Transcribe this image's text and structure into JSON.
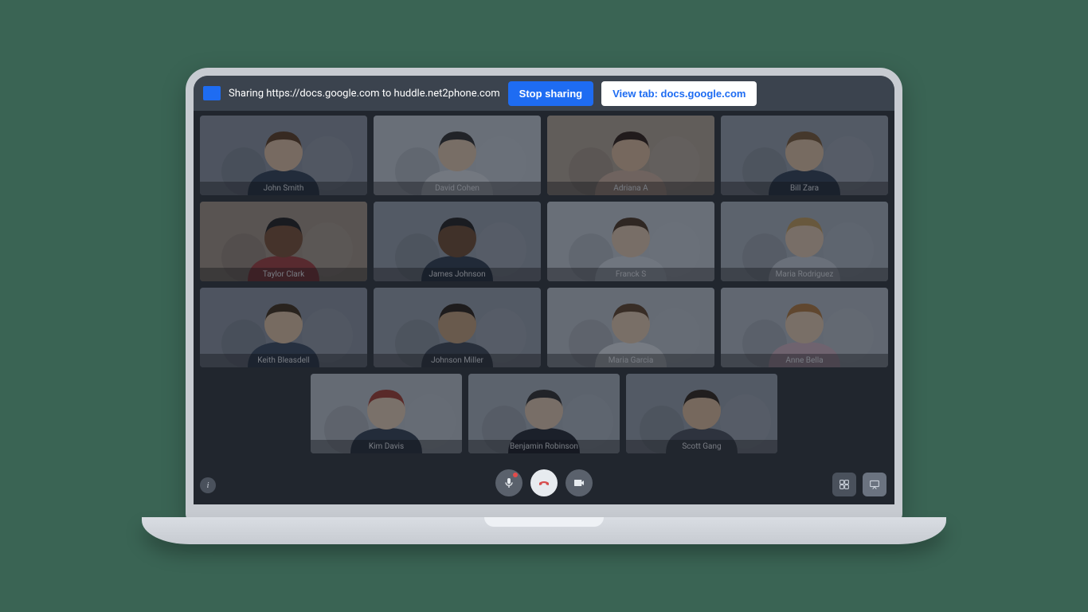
{
  "share_bar": {
    "sharing_text": "Sharing https://docs.google.com to huddle.net2phone.com",
    "stop_label": "Stop sharing",
    "view_label": "View tab: docs.google.com"
  },
  "participants": [
    {
      "name": "John Smith",
      "skin": "#e8c7a8",
      "hair": "#5b3a1e",
      "shirt": "#2d3e55"
    },
    {
      "name": "David Cohen",
      "skin": "#ecd0b3",
      "hair": "#2c2c2c",
      "shirt": "#dfe6ee"
    },
    {
      "name": "Adriana A",
      "skin": "#e6c4a2",
      "hair": "#2a1a10",
      "shirt": "#d7b8a4"
    },
    {
      "name": "Bill Zara",
      "skin": "#e9caa9",
      "hair": "#7a5a34",
      "shirt": "#2d3e55"
    },
    {
      "name": "Taylor Clark",
      "skin": "#7a4f32",
      "hair": "#1a1a1a",
      "shirt": "#a53a3a"
    },
    {
      "name": "James Johnson",
      "skin": "#6f4a2e",
      "hair": "#1b1b1b",
      "shirt": "#2b3a4f"
    },
    {
      "name": "Franck S",
      "skin": "#ecd1b5",
      "hair": "#4b3420",
      "shirt": "#d9e2ec"
    },
    {
      "name": "Maria Rodriguez",
      "skin": "#ecd1b5",
      "hair": "#c8a15a",
      "shirt": "#cdd6df"
    },
    {
      "name": "Keith Bleasdell",
      "skin": "#e9caa9",
      "hair": "#3c2a16",
      "shirt": "#36485f"
    },
    {
      "name": "Johnson Miller",
      "skin": "#caa57c",
      "hair": "#241b12",
      "shirt": "#3a4655"
    },
    {
      "name": "Maria Garcia",
      "skin": "#eed3b7",
      "hair": "#5d4126",
      "shirt": "#e7edf3"
    },
    {
      "name": "Anne Bella",
      "skin": "#eed3b7",
      "hair": "#b57a3b",
      "shirt": "#d7b8c8"
    },
    {
      "name": "Kim Davis",
      "skin": "#f0d7bd",
      "hair": "#a63b2e",
      "shirt": "#2f3e52"
    },
    {
      "name": "Benjamin Robinson",
      "skin": "#ecd1b5",
      "hair": "#2c2c2c",
      "shirt": "#1e2430"
    },
    {
      "name": "Scott Gang",
      "skin": "#e6c3a0",
      "hair": "#2a1f14",
      "shirt": "#474f5b"
    }
  ],
  "controls": {
    "mic": "microphone-toggle",
    "hangup": "end-call",
    "camera": "camera-toggle",
    "info": "info",
    "grid_view": "grid-view",
    "present": "presentation-view"
  }
}
